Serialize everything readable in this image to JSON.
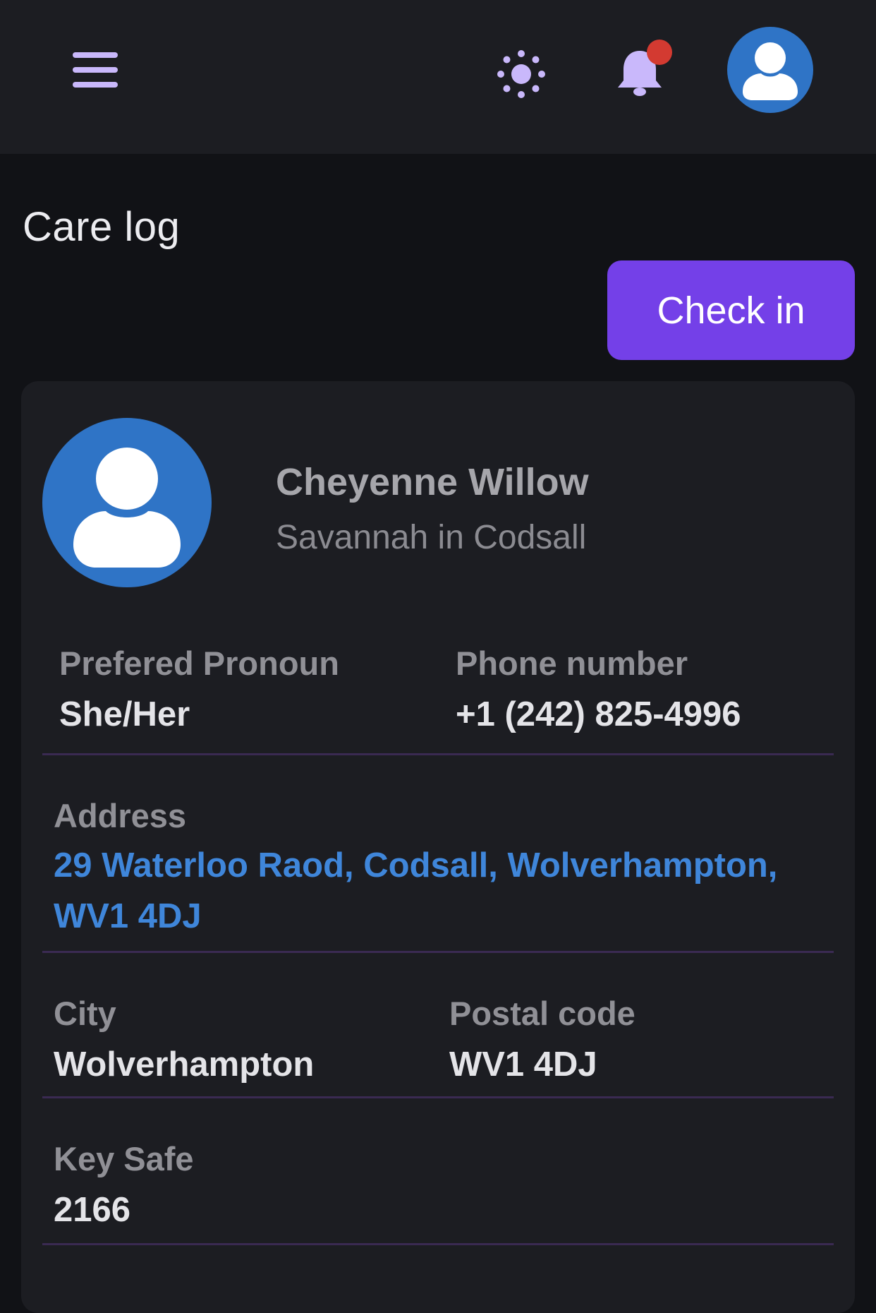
{
  "header": {
    "menu_icon": "hamburger-menu-icon",
    "theme_icon": "sun-icon",
    "notification_icon": "bell-icon",
    "profile_icon": "user-avatar-icon",
    "accent_color": "#c9b8fb",
    "notification_dot_color": "#d33a31"
  },
  "page": {
    "title": "Care log",
    "check_in_label": "Check in",
    "check_in_color": "#7440e8"
  },
  "client": {
    "name": "Cheyenne Willow",
    "subtitle": "Savannah in Codsall",
    "avatar_icon": "user-avatar-icon",
    "avatar_color": "#2f74c6"
  },
  "details": {
    "pronoun_label": "Prefered Pronoun",
    "pronoun_value": "She/Her",
    "phone_label": "Phone number",
    "phone_value": "+1 (242) 825-4996",
    "address_label": "Address",
    "address_value": "29 Waterloo Raod, Codsall, Wolverhampton, WV1 4DJ",
    "city_label": "City",
    "city_value": "Wolverhampton",
    "postal_label": "Postal code",
    "postal_value": "WV1 4DJ",
    "keysafe_label": "Key Safe",
    "keysafe_value": "2166"
  }
}
